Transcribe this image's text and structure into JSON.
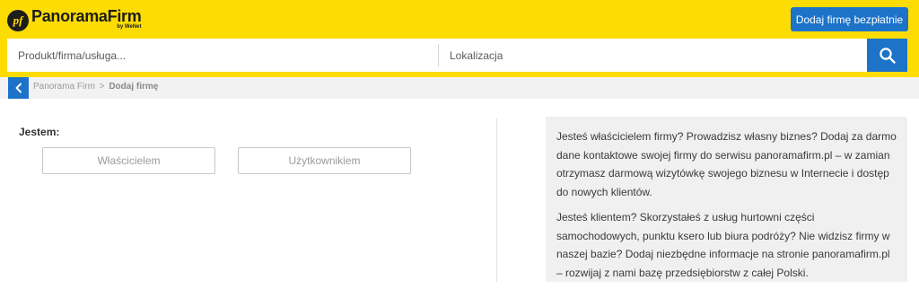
{
  "brand": {
    "badge": "pf",
    "name": "PanoramaFirm",
    "sub": "by WeNet"
  },
  "header": {
    "add_company_label": "Dodaj firmę bezpłatnie"
  },
  "search": {
    "product_placeholder": "Produkt/firma/usługa...",
    "location_placeholder": "Lokalizacja"
  },
  "breadcrumb": {
    "home": "Panorama Firm",
    "separator": ">",
    "current": "Dodaj firmę"
  },
  "form": {
    "label": "Jestem:",
    "owner_label": "Właścicielem",
    "user_label": "Użytkownikiem"
  },
  "info": {
    "paragraph_owner": "Jesteś właścicielem firmy? Prowadzisz własny biznes? Dodaj za darmo dane kontaktowe swojej firmy do serwisu panoramafirm.pl – w zamian otrzymasz darmową wizytówkę swojego biznesu w Internecie i dostęp do nowych klientów.",
    "paragraph_client": "Jesteś klientem? Skorzystałeś z usług hurtowni części samochodowych, punktu ksero lub biura podróży? Nie widzisz firmy w naszej bazie? Dodaj niezbędne informacje na stronie panoramafirm.pl – rozwijaj z nami bazę przedsiębiorstw z całej Polski."
  },
  "icons": {
    "search": "search-icon",
    "back": "chevron-left-icon"
  },
  "colors": {
    "header_yellow": "#fddc03",
    "accent_blue": "#1c73c8"
  }
}
